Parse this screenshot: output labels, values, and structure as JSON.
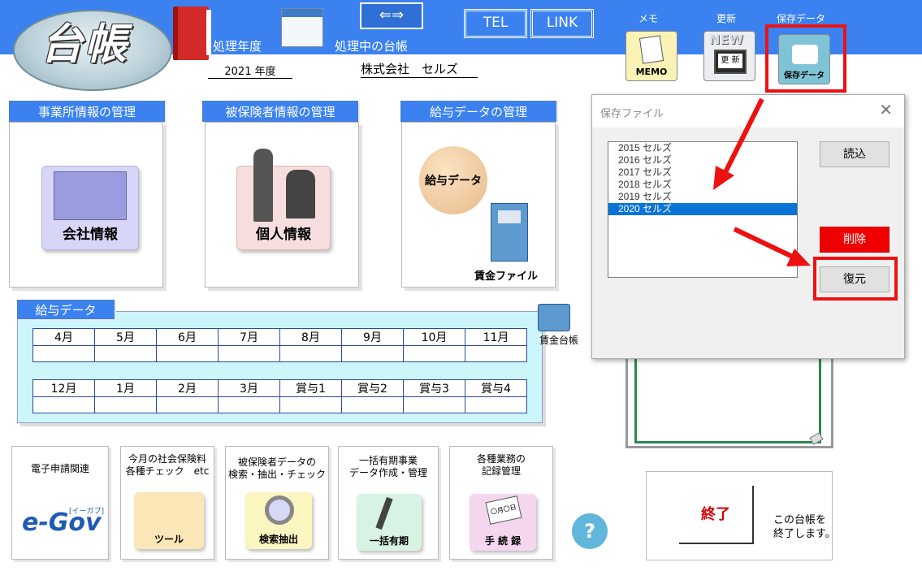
{
  "app": {
    "logo": "台帳",
    "fiscal_year_label": "処理年度",
    "fiscal_year_value": "2021 年度",
    "current_ledger_label": "処理中の台帳",
    "current_ledger_value": "株式会社　セルズ",
    "switch_icon": "⇐⇒",
    "tel_label": "TEL",
    "link_label": "LINK"
  },
  "top_icons": [
    {
      "caption": "メモ",
      "label": "MEMO"
    },
    {
      "caption": "更新",
      "label": "更 新",
      "badge": "NEW"
    },
    {
      "caption": "保存データ",
      "label": "保存データ"
    }
  ],
  "sections": {
    "office": {
      "title": "事業所情報の管理",
      "button": "会社情報"
    },
    "insured": {
      "title": "被保険者情報の管理",
      "button": "個人情報"
    },
    "salary": {
      "title": "給与データの管理",
      "button": "給与データ",
      "file": "賃金ファイル"
    }
  },
  "salary_data": {
    "title": "給与データ",
    "row1": [
      "4月",
      "5月",
      "6月",
      "7月",
      "8月",
      "9月",
      "10月",
      "11月"
    ],
    "row2": [
      "12月",
      "1月",
      "2月",
      "3月",
      "賞与1",
      "賞与2",
      "賞与3",
      "賞与4"
    ],
    "ledger_label": "賃金台帳"
  },
  "bottom": [
    {
      "text": "電子申請関連",
      "sub": "e-Gov",
      "sub2": "[イーガブ]"
    },
    {
      "text": "今月の社会保険料\n各種チェック　etc",
      "sub": "ツール"
    },
    {
      "text": "被保険者データの\n検索・抽出・チェック",
      "sub": "検索抽出"
    },
    {
      "text": "一括有期事業\nデータ作成・管理",
      "sub": "一括有期"
    },
    {
      "text": "各種業務の\n記録管理",
      "sub": "手 続 録",
      "card": "〇月〇日"
    }
  ],
  "exit": {
    "button": "終了",
    "desc": "この台帳を\n終了します。"
  },
  "help": "?",
  "dialog": {
    "title": "保存ファイル",
    "close": "✕",
    "files": [
      "2015 セルズ",
      "2016 セルズ",
      "2017 セルズ",
      "2018 セルズ",
      "2019 セルズ",
      "2020 セルズ"
    ],
    "selected_index": 5,
    "load": "読込",
    "delete": "削除",
    "restore": "復元"
  },
  "colors": {
    "accent_blue": "#3b82f0",
    "highlight_red": "#ee1111",
    "selection": "#0a73d6",
    "delete_red": "#ee0000"
  }
}
